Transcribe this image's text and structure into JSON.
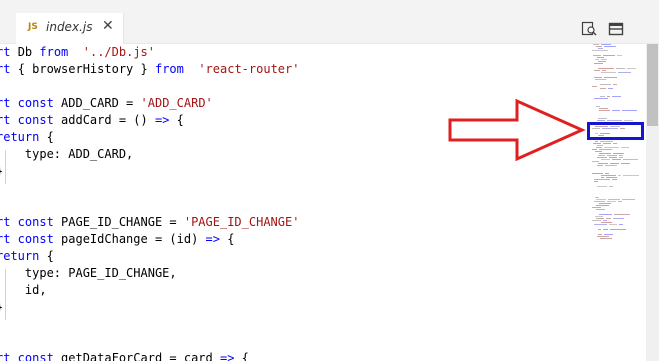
{
  "tab": {
    "file_type_label": "JS",
    "file_name": "index.js",
    "close_glyph": "✕"
  },
  "toolbar": {
    "icons": [
      "open-changes-icon",
      "split-editor-icon"
    ]
  },
  "code_lines": [
    [
      [
        "kw",
        "rt"
      ],
      [
        "",
        "Db "
      ],
      [
        "kw",
        "from"
      ],
      [
        "",
        ""
      ],
      [
        "str",
        " '../Db.js'"
      ]
    ],
    [
      [
        "kw",
        "rt"
      ],
      [
        "",
        "{ browserHistory } "
      ],
      [
        "kw",
        "from"
      ],
      [
        "str",
        " 'react-router'"
      ]
    ],
    [],
    [
      [
        "kw",
        "rt const"
      ],
      [
        "",
        "ADD_CARD = "
      ],
      [
        "str",
        "'ADD_CARD'"
      ]
    ],
    [
      [
        "kw",
        "rt const"
      ],
      [
        "",
        "addCard = () "
      ],
      [
        "kw",
        "=>"
      ],
      [
        "",
        ""
      ],
      [
        "",
        ""
      ],
      [
        "",
        "{"
      ]
    ],
    [
      [
        "kw",
        "return"
      ],
      [
        "",
        ""
      ],
      [
        "",
        "{"
      ]
    ],
    [
      [
        "",
        "    type: ADD_CARD,"
      ]
    ],
    [
      [
        "",
        "}"
      ]
    ],
    [],
    [],
    [
      [
        "kw",
        "rt const"
      ],
      [
        "",
        "PAGE_ID_CHANGE = "
      ],
      [
        "str",
        "'PAGE_ID_CHANGE'"
      ]
    ],
    [
      [
        "kw",
        "rt const"
      ],
      [
        "",
        "pageIdChange = (id) "
      ],
      [
        "kw",
        "=>"
      ],
      [
        "",
        ""
      ],
      [
        "",
        "{"
      ]
    ],
    [
      [
        "kw",
        "return"
      ],
      [
        "",
        ""
      ],
      [
        "",
        "{"
      ]
    ],
    [
      [
        "",
        "    type: PAGE_ID_CHANGE,"
      ]
    ],
    [
      [
        "",
        "    id,"
      ]
    ],
    [
      [
        "",
        "}"
      ]
    ],
    [],
    [],
    [
      [
        "kw",
        "rt const"
      ],
      [
        "",
        "getDataForCard = card "
      ],
      [
        "kw",
        "=>"
      ],
      [
        "",
        ""
      ],
      [
        "",
        "{"
      ]
    ]
  ],
  "colors": {
    "keyword": "#0000ff",
    "string": "#a31515",
    "arrow": "#e02020",
    "highlight_box": "#1515cc"
  }
}
